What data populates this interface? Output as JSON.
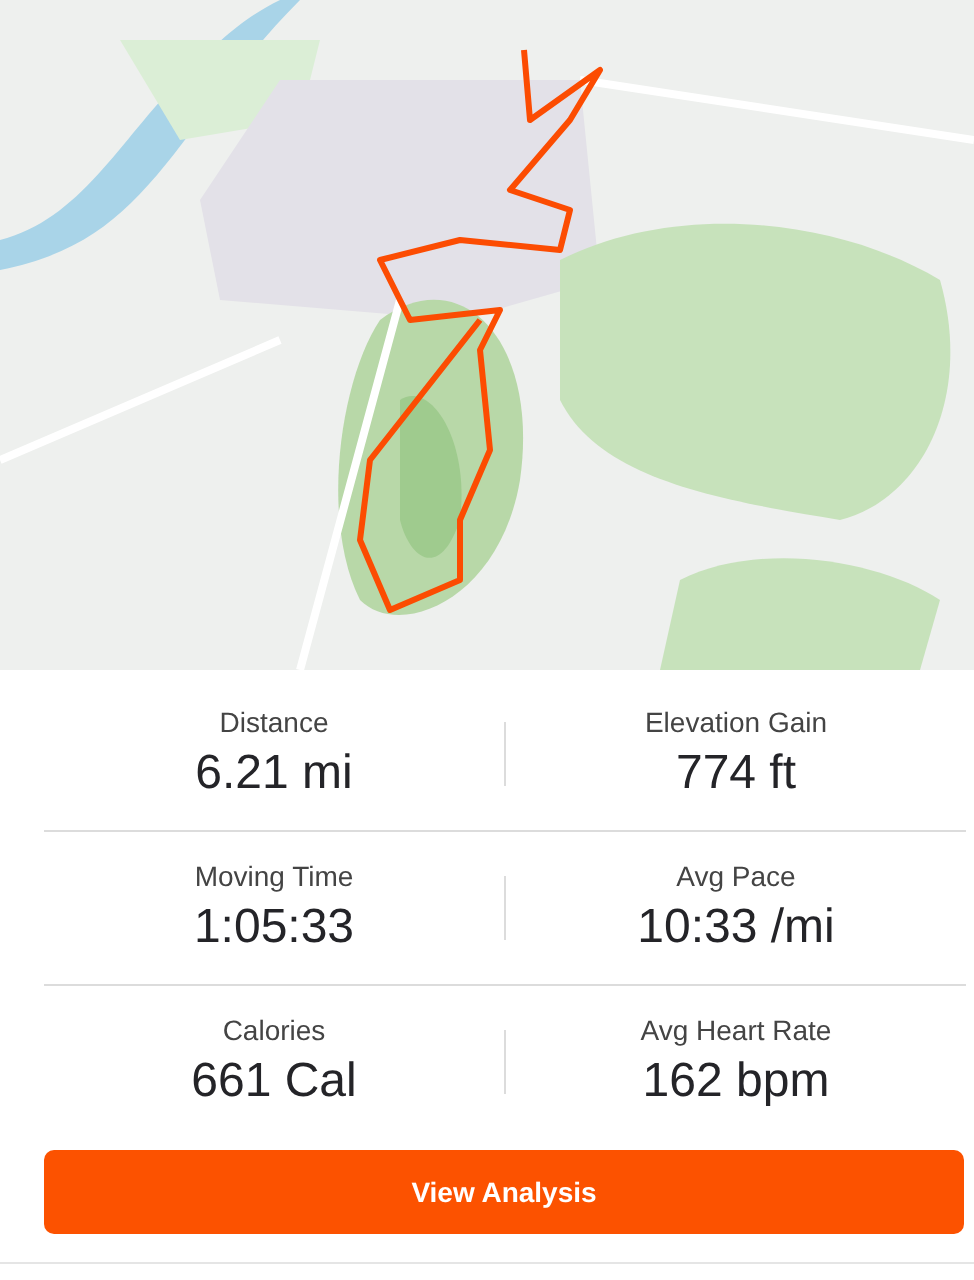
{
  "stats": [
    {
      "label": "Distance",
      "value": "6.21 mi"
    },
    {
      "label": "Elevation Gain",
      "value": "774 ft"
    },
    {
      "label": "Moving Time",
      "value": "1:05:33"
    },
    {
      "label": "Avg Pace",
      "value": "10:33 /mi"
    },
    {
      "label": "Calories",
      "value": "661 Cal"
    },
    {
      "label": "Avg Heart Rate",
      "value": "162 bpm"
    }
  ],
  "button": "View Analysis"
}
